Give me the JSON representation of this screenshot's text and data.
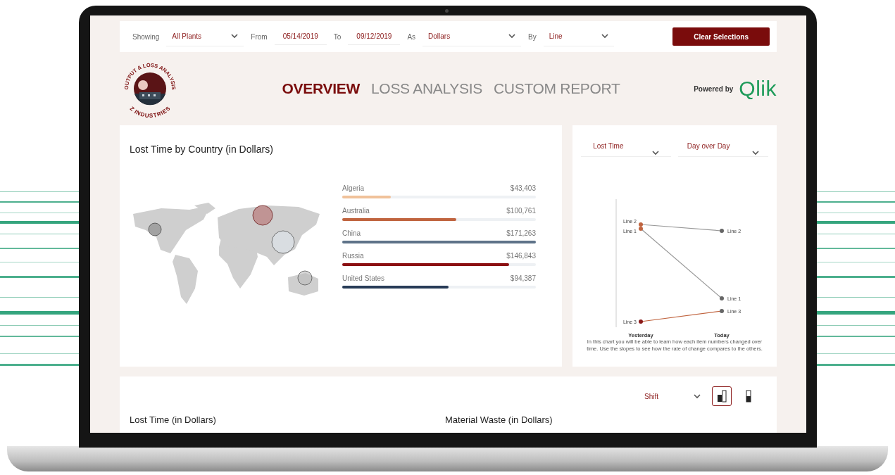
{
  "filters": [
    {
      "kind": "label",
      "text": "Showing"
    },
    {
      "kind": "dropdown",
      "value": "All Plants"
    },
    {
      "kind": "label",
      "text": "From"
    },
    {
      "kind": "date",
      "value": "05/14/2019"
    },
    {
      "kind": "label",
      "text": "To"
    },
    {
      "kind": "date",
      "value": "09/12/2019"
    },
    {
      "kind": "label",
      "text": "As"
    },
    {
      "kind": "dropdown",
      "value": "Dollars"
    },
    {
      "kind": "label",
      "text": "By"
    },
    {
      "kind": "dropdown",
      "value": "Line"
    },
    {
      "kind": "button",
      "text": "Clear Selections"
    }
  ],
  "logo": {
    "top_text": "OUTPUT & LOSS ANALYSIS",
    "bottom_text": "Z INDUSTRIES"
  },
  "tabs": [
    {
      "label": "OVERVIEW",
      "selected": true
    },
    {
      "label": "LOSS ANALYSIS",
      "selected": false
    },
    {
      "label": "CUSTOM REPORT",
      "selected": false
    }
  ],
  "powered_by": {
    "text": "Powered by",
    "brand": "Qlik"
  },
  "country_card": {
    "title": "Lost Time by Country (in Dollars)",
    "rows": [
      {
        "name": "Algeria",
        "value": "$43,403",
        "level": 0.25,
        "color": "#f0c29a"
      },
      {
        "name": "Australia",
        "value": "$100,761",
        "level": 0.59,
        "color": "#c0643f"
      },
      {
        "name": "China",
        "value": "$171,263",
        "level": 1,
        "color": "#5e7389"
      },
      {
        "name": "Russia",
        "value": "$146,843",
        "level": 0.86,
        "color": "#8b0f12"
      },
      {
        "name": "United States",
        "value": "$94,387",
        "level": 0.55,
        "color": "#273b57"
      }
    ]
  },
  "slope_card": {
    "dropdowns": [
      "Lost Time",
      "Day over Day"
    ],
    "lines": [
      {
        "start_label": "Line 2",
        "end_label": "Line 2"
      },
      {
        "start_label": "Line 1",
        "end_label": "Line 1"
      },
      {
        "start_label": "Line 3",
        "end_label": "Line 3"
      }
    ],
    "x_labels": [
      "Yesterday",
      "Today"
    ],
    "caption": "In this chart you will be able to learn how each item numbers changed over time. Use the slopes to see how the rate of change compares to the others."
  },
  "bottom_card": {
    "dropdown": "Shift",
    "view_toggles": [
      {
        "selected": true
      },
      {
        "selected": false
      }
    ],
    "titles": [
      "Lost Time (in Dollars)",
      "Material Waste (in Dollars)"
    ]
  }
}
